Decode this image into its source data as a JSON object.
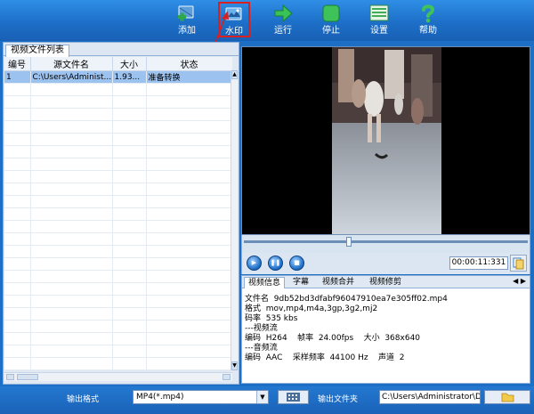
{
  "toolbar": {
    "add_label": "添加",
    "watermark_label": "水印",
    "run_label": "运行",
    "stop_label": "停止",
    "settings_label": "设置",
    "help_label": "帮助"
  },
  "file_list": {
    "tab_label": "视频文件列表",
    "columns": [
      "编号",
      "源文件名",
      "大小",
      "状态"
    ],
    "rows": [
      {
        "index": "1",
        "filename": "C:\\Users\\Administ...",
        "size": "1.93...",
        "status": "准备转换"
      }
    ]
  },
  "player": {
    "time": "00:00:11:331",
    "seek_fraction": 0.37
  },
  "info": {
    "tabs": [
      "视频信息",
      "字幕",
      "视频合并",
      "视频修剪"
    ],
    "filename_label": "文件名",
    "filename": "9db52bd3dfabf96047910ea7e305ff02.mp4",
    "format_label": "格式",
    "format": "mov,mp4,m4a,3gp,3g2,mj2",
    "bitrate_label": "码率",
    "bitrate": "535 kbs",
    "video_stream": "---视频流",
    "video_line": "编码  H264    帧率  24.00fps    大小  368x640",
    "audio_stream": "---音频流",
    "audio_line": "编码  AAC    采样频率  44100 Hz    声道  2"
  },
  "bottom": {
    "format_label": "输出格式",
    "format_value": "MP4(*.mp4)",
    "folder_label": "输出文件夹",
    "folder_value": "C:\\Users\\Administrator\\De"
  }
}
